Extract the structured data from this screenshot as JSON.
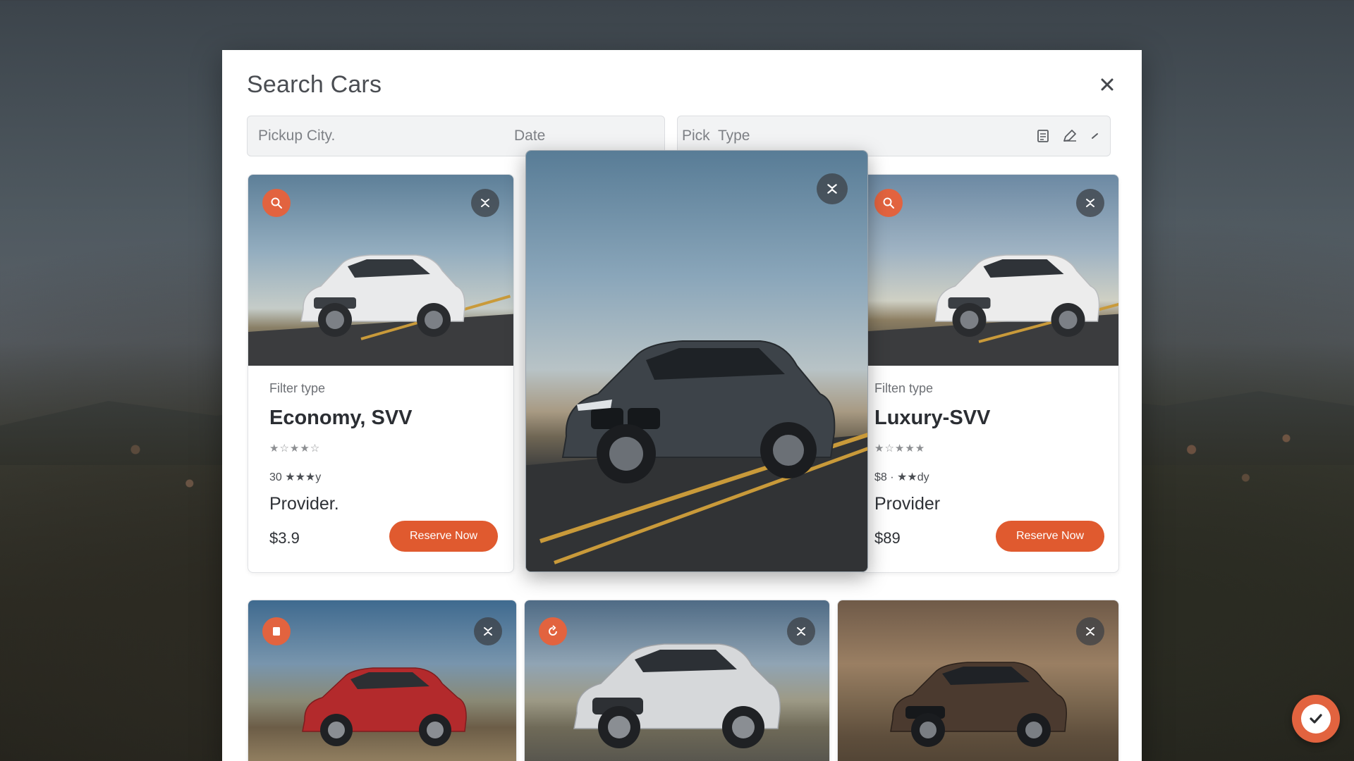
{
  "modal": {
    "title": "Search Cars",
    "close_icon": "close-icon"
  },
  "search": {
    "pickup_placeholder": "Pickup City.",
    "date_placeholder": "Date",
    "type_placeholder": "Pick  Type",
    "icons": [
      "document-icon",
      "edit-icon",
      "collapse-icon"
    ]
  },
  "cards": [
    {
      "filter_label": "Filter type",
      "title": "Economy, SVV",
      "stars": "★☆★★☆",
      "rating_text": "30 ★★★y",
      "provider": "Provider.",
      "price": "$3.9",
      "button": "Reserve Now",
      "car_color": "#e9eaeb"
    },
    {
      "featured": true,
      "car_color": "#3d4349"
    },
    {
      "filter_label": "Filten type",
      "title": "Luxury-SVV",
      "stars": "★☆★★★",
      "rating_text": "$8 · ★★dy",
      "provider": "Provider",
      "price": "$89",
      "button": "Reserve Now",
      "car_color": "#ececec"
    }
  ],
  "bottom_cards": [
    {
      "car_color": "#b32a2c",
      "badge_icon": "bookmark-icon"
    },
    {
      "car_color": "#d6d8da",
      "badge_icon": "refresh-icon"
    },
    {
      "car_color": "#4b3a2f"
    }
  ],
  "colors": {
    "accent": "#e05a2f",
    "title_text": "#4a4d52"
  },
  "fab": {
    "icon": "check-icon"
  }
}
